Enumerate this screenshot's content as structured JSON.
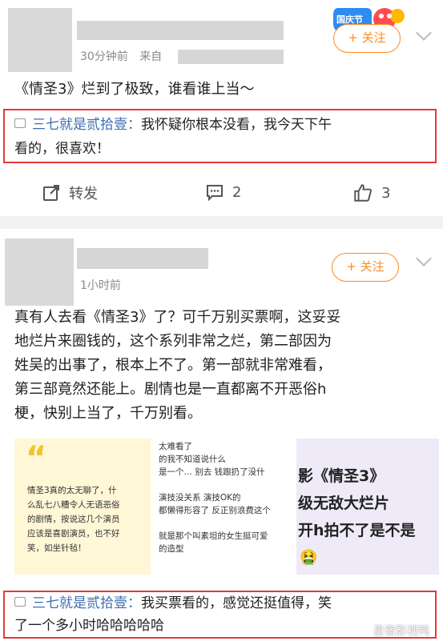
{
  "post1": {
    "time": "30分钟前",
    "from_label": "来自",
    "follow_label": "+ 关注",
    "badge_text": "国庆节",
    "body": "《情圣3》烂到了极致，谁看谁上当～",
    "hot_comment": {
      "user": "三七就是贰拾壹：",
      "line1": "我怀疑你根本没看，我今天下午",
      "line2": "看的，很喜欢！"
    },
    "actions": {
      "repost": "转发",
      "comments": "2",
      "likes": "3"
    }
  },
  "post2": {
    "time": "1小时前",
    "follow_label": "+ 关注",
    "body_lines": [
      "真有人去看《情圣3》了？可千万别买票啊，这妥妥",
      "地烂片来圈钱的，这个系列非常之烂，第二部因为",
      "姓吴的出事了，根本上不了。第一部就非常难看，",
      "第三部竟然还能上。剧情也是一直都离不开恶俗h",
      "梗，快别上当了，千万别看。"
    ],
    "img1": {
      "quote": "“",
      "lines": [
        "情圣3真的太无聊了，什",
        "么乱七八糟令人无语恶俗",
        "的剧情，按说这几个演员",
        "应该是喜剧演员，也不好",
        "笑，如坐针毡！"
      ]
    },
    "img2": {
      "lines": [
        "太难看了",
        "的我不知道说什么",
        "是一个… 别去 钱跟扔了没什",
        "",
        "演技没关系 演技OK的",
        "都懒得形容了 反正别浪费这个",
        "",
        "就是那个叫素坦的女生挺可爱",
        "的造型"
      ]
    },
    "img3": {
      "lines": [
        "影《情圣3》",
        "级无敌大烂片",
        "开h拍不了是不是"
      ],
      "emoji": "🤮"
    },
    "hot_comment": {
      "user": "三七就是贰拾壹：",
      "line1": "我买票看的，感觉还挺值得，笑",
      "line2": "了一个多小时哈哈哈哈哈"
    }
  },
  "watermark": "星宿影视鸭",
  "colors": {
    "accent": "#ff8a1f",
    "highlight_border": "#e23b3b",
    "username": "#3b6db0"
  }
}
